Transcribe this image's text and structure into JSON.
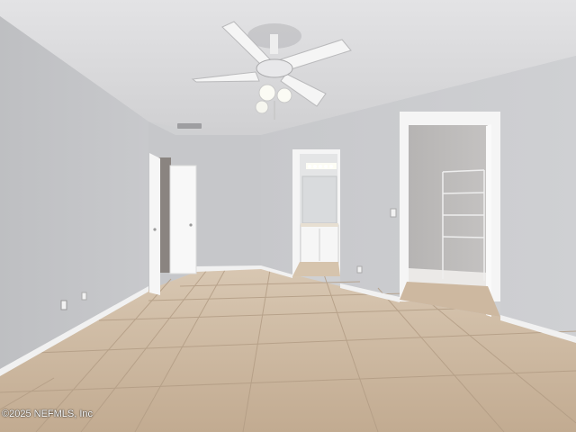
{
  "photo": {
    "subject": "vacant-bedroom-interior",
    "watermark": "©2025 NEFMLS, Inc",
    "colors": {
      "wall": "#c9cacc",
      "ceiling": "#dcdcde",
      "floor_tile": "#c8b39a",
      "trim": "#f4f4f4"
    },
    "icons": [
      "ceiling-fan-icon",
      "door-icon",
      "closet-shelf-icon",
      "vanity-icon"
    ]
  }
}
